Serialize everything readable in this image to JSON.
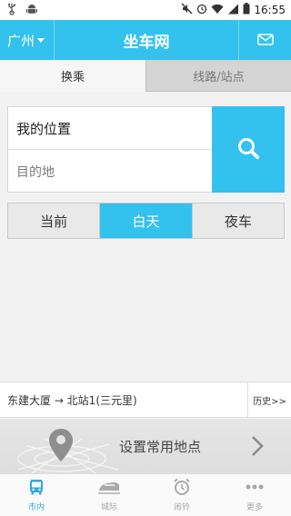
{
  "status_bar": {
    "time": "16:55",
    "icons": [
      "usb-icon",
      "android-icon",
      "mute-icon",
      "alarm-icon",
      "wifi-icon",
      "signal-icon",
      "battery-icon"
    ]
  },
  "header": {
    "city": "广州",
    "title": "坐车网",
    "message_icon": "mail-icon"
  },
  "tabs": [
    {
      "label": "换乘",
      "active": true
    },
    {
      "label": "线路/站点",
      "active": false
    }
  ],
  "search": {
    "from_value": "我的位置",
    "to_placeholder": "目的地",
    "button_icon": "search-icon"
  },
  "time_segments": [
    {
      "label": "当前",
      "active": false
    },
    {
      "label": "白天",
      "active": true
    },
    {
      "label": "夜车",
      "active": false
    }
  ],
  "history": {
    "route_text": "东建大厦 → 北站1(三元里)",
    "more_label": "历史>>"
  },
  "common_places": {
    "label": "设置常用地点",
    "icon": "location-pin-icon"
  },
  "bottom_nav": [
    {
      "label": "市内",
      "icon": "bus-icon",
      "active": true
    },
    {
      "label": "城际",
      "icon": "train-icon",
      "active": false
    },
    {
      "label": "闹铃",
      "icon": "alarm-clock-icon",
      "active": false
    },
    {
      "label": "更多",
      "icon": "more-icon",
      "active": false
    }
  ],
  "colors": {
    "accent": "#33c1ee",
    "nav_active": "#33a8e2"
  }
}
